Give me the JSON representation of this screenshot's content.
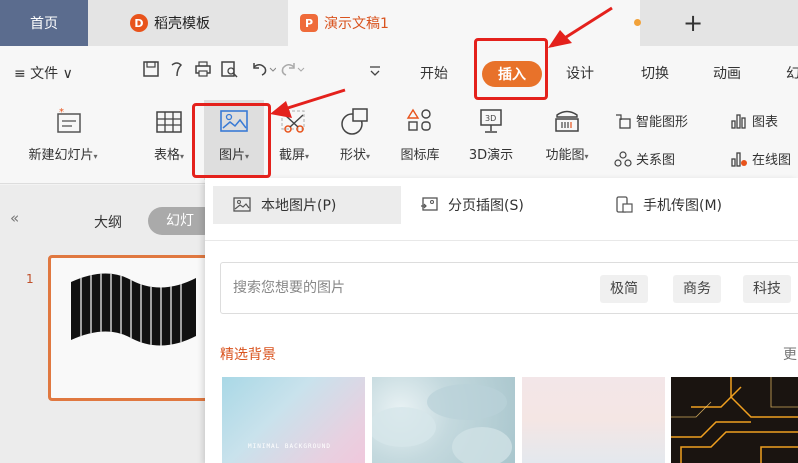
{
  "tabs": {
    "home": "首页",
    "templates": "稻壳模板",
    "document": "演示文稿1",
    "add": "+"
  },
  "menubar": {
    "file": "≡ 文件 ∨",
    "tabs": [
      "开始",
      "插入",
      "设计",
      "切换",
      "动画",
      "幻"
    ],
    "active_tab": "插入"
  },
  "ribbon": {
    "new_slide": "新建幻灯片",
    "table": "表格",
    "picture": "图片",
    "screenshot": "截屏",
    "shape": "形状",
    "icon_lib": "图标库",
    "demo3d": "3D演示",
    "func_chart": "功能图",
    "smart_art": "智能图形",
    "chart": "图表",
    "relation": "关系图",
    "online": "在线图"
  },
  "leftpanel": {
    "collapse": "«",
    "outline": "大纲",
    "slides": "幻灯",
    "slide_number": "1"
  },
  "dropdown": {
    "local_picture": "本地图片(P)",
    "paged_insert": "分页插图(S)",
    "phone_picture": "手机传图(M)",
    "search_placeholder": "搜索您想要的图片",
    "tags": [
      "极简",
      "商务",
      "科技"
    ],
    "featured_title": "精选背景",
    "more": "更",
    "thumb1_caption": "MINIMAL BACKGROUND"
  },
  "colors": {
    "accent": "#e8722a",
    "highlight": "#e4211c",
    "home_tab": "#5b6c8e"
  }
}
